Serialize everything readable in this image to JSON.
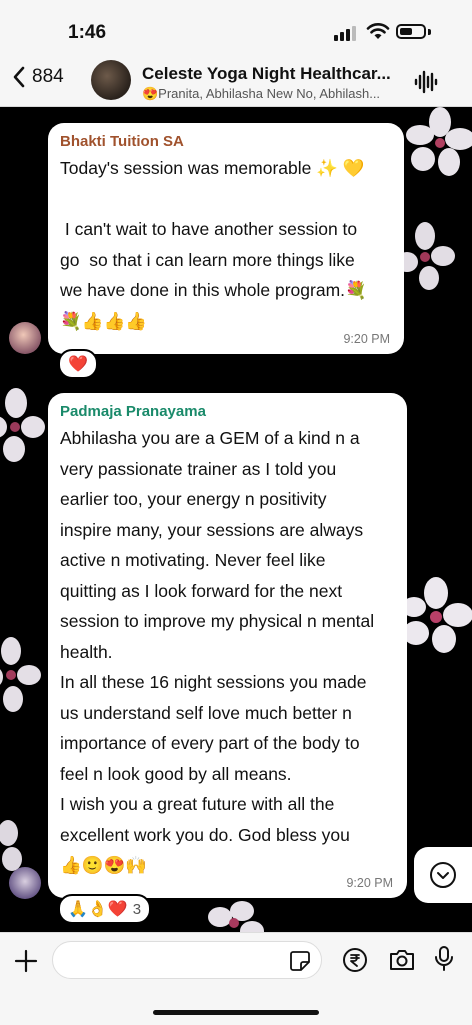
{
  "status_bar": {
    "time": "1:46"
  },
  "header": {
    "back_count": "884",
    "title": "Celeste Yoga Night Healthcar...",
    "subtitle": "😍Pranita, Abhilasha New No, Abhilash..."
  },
  "messages": [
    {
      "sender": "Bhakti Tuition SA",
      "sender_color": "#a0522d",
      "text": "Today's session was memorable ✨ 💛\n\n I can't wait to have another session to\ngo  so that i can learn more things like\nwe have done in this whole program.💐\n💐👍👍👍",
      "time": "9:20 PM",
      "reactions": "❤️"
    },
    {
      "sender": "Padmaja Pranayama",
      "sender_color": "#1a8a6a",
      "text": "Abhilasha you are a GEM of a kind n a\nvery passionate trainer as I told you\nearlier too, your energy n positivity\ninspire many, your sessions are always\nactive n motivating. Never feel like\nquitting as I look forward for the next\nsession to improve my physical n mental\nhealth.\nIn all these 16 night sessions you made\nus understand self love much better n\nimportance of every part of the body to\nfeel n look good by all means.\nI wish you a great future with all the\nexcellent work you do. God bless you\n👍🙂😍🙌",
      "time": "9:20 PM",
      "reactions": "🙏👌❤️",
      "reaction_count": "3"
    }
  ],
  "icons": {
    "back": "chevron-left-icon",
    "voice": "waveform-icon",
    "scroll": "chevron-down-icon",
    "add": "plus-icon",
    "sticker": "sticker-icon",
    "payment": "rupee-icon",
    "camera": "camera-icon",
    "mic": "microphone-icon"
  }
}
